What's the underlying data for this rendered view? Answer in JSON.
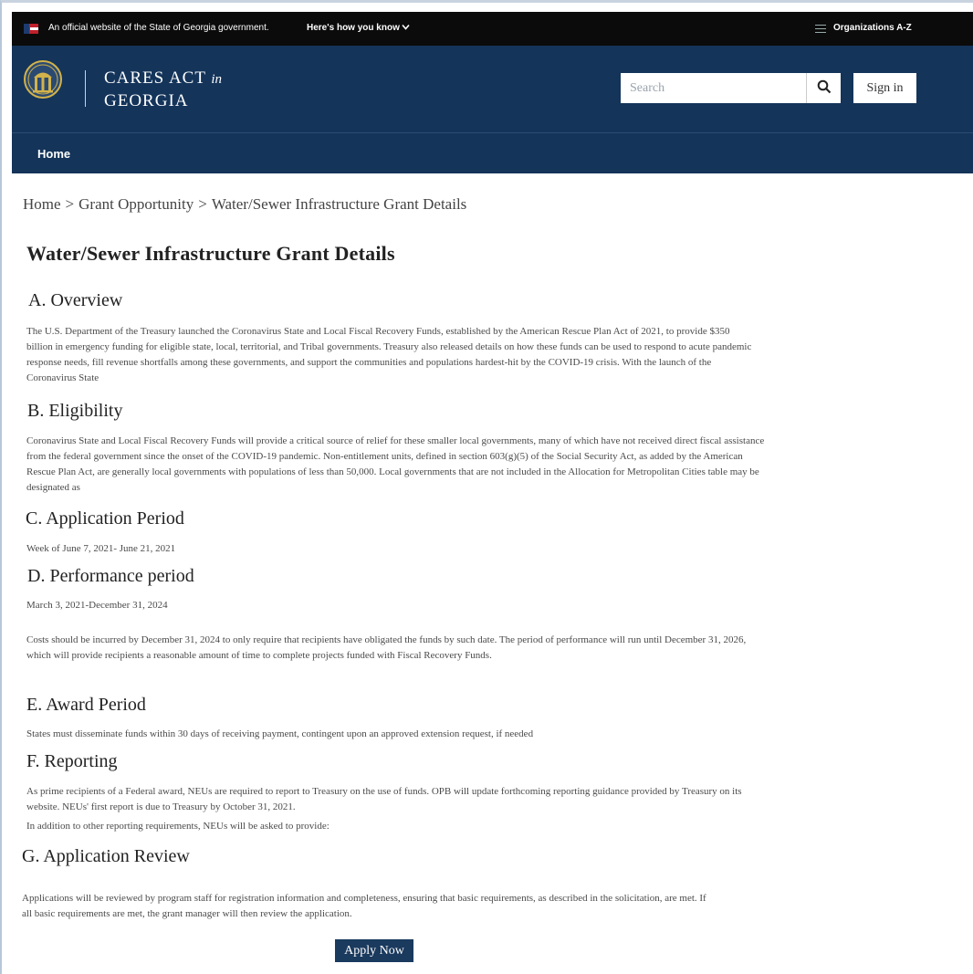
{
  "gov_banner": {
    "official_text": "An official website of the State of Georgia government.",
    "how_you_know": "Here's how you know",
    "organizations_link": "Organizations A-Z"
  },
  "header": {
    "brand_line1": "CARES ACT",
    "brand_in": "in",
    "brand_line2": "GEORGIA",
    "search_placeholder": "Search",
    "sign_in_label": "Sign in"
  },
  "nav": {
    "home_label": "Home"
  },
  "breadcrumb": [
    "Home",
    "Grant Opportunity",
    "Water/Sewer Infrastructure Grant Details"
  ],
  "breadcrumb_separator": ">",
  "page_title": "Water/Sewer Infrastructure Grant Details",
  "sections": {
    "overview": {
      "heading": "A. Overview",
      "body": "The U.S. Department of the Treasury launched the Coronavirus State and Local Fiscal Recovery Funds, established by the American Rescue Plan Act of 2021, to provide $350 billion in emergency funding for eligible state, local, territorial, and Tribal governments. Treasury also released details on how these funds can be used to respond to acute pandemic response needs, fill revenue shortfalls among these governments, and support the communities and populations hardest-hit by the COVID-19 crisis. With the launch of the Coronavirus State"
    },
    "eligibility": {
      "heading": "B. Eligibility",
      "body": "Coronavirus State and Local Fiscal Recovery Funds will provide a critical source of relief for these smaller local governments, many of which have not received direct fiscal assistance from the federal government since the onset of the COVID-19 pandemic. Non-entitlement units, defined in section 603(g)(5) of the Social Security Act, as added by the American Rescue Plan Act, are generally local governments with populations of less than 50,000. Local governments that are not included in the Allocation for Metropolitan Cities table may be designated as"
    },
    "application_period": {
      "heading": "C. Application Period",
      "body": "Week of June 7, 2021- June 21, 2021"
    },
    "performance_period": {
      "heading": "D. Performance period",
      "dates": "March 3, 2021-December 31, 2024",
      "body": "Costs should be incurred by December 31, 2024 to only require that recipients have obligated the funds by such date. The period of performance will run until December 31, 2026, which will provide recipients a reasonable amount of time to complete projects funded with Fiscal Recovery Funds."
    },
    "award_period": {
      "heading": "E. Award Period",
      "body": "States must disseminate funds within 30 days of receiving payment, contingent upon an approved extension request, if needed"
    },
    "reporting": {
      "heading": "F. Reporting",
      "body": "As prime recipients of a Federal award, NEUs are required to report to Treasury on the use of funds. OPB will update forthcoming reporting guidance provided by Treasury on its website. NEUs' first report is due to Treasury by October 31, 2021.",
      "body2": "In addition to other reporting requirements, NEUs will be asked to provide:"
    },
    "application_review": {
      "heading": "G. Application Review",
      "body": "Applications will be reviewed by program staff for registration information and completeness, ensuring that basic requirements, as described in the solicitation, are met. If all basic requirements are met, the grant manager will then review the application."
    }
  },
  "apply_label": "Apply Now",
  "colors": {
    "header_bg": "#14345a",
    "gov_bar_bg": "#0b0b0b",
    "button_bg": "#1a3a5e"
  }
}
